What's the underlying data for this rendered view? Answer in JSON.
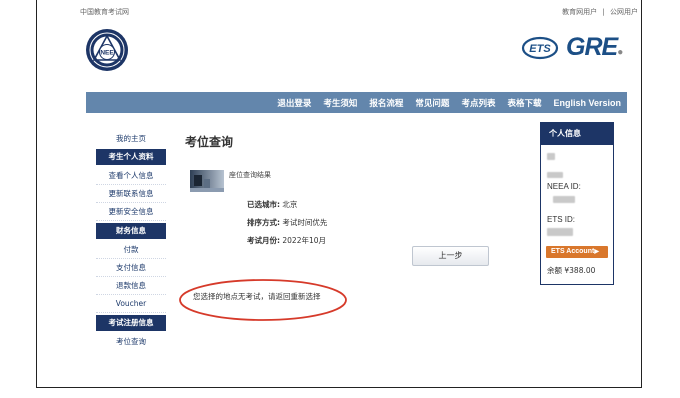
{
  "header": {
    "site_name": "中国教育考试网",
    "user_links": [
      "教育网用户",
      "公网用户"
    ],
    "link_sep": "|",
    "gre_logo": "GRE",
    "gre_dot": "●"
  },
  "nav": {
    "items": [
      "退出登录",
      "考生须知",
      "报名流程",
      "常见问题",
      "考点列表",
      "表格下载",
      "English Version"
    ]
  },
  "sidebar": {
    "home": "我的主页",
    "section1": "考生个人资料",
    "items1": [
      "查看个人信息",
      "更新联系信息",
      "更新安全信息"
    ],
    "section2": "财务信息",
    "items2": [
      "付款",
      "支付信息",
      "退款信息",
      "Voucher"
    ],
    "section3": "考试注册信息",
    "items3": [
      "考位查询"
    ]
  },
  "main": {
    "title": "考位查询",
    "result_label": "座位查询结果",
    "city_label": "已选城市:",
    "city_value": "北京",
    "sort_label": "排序方式:",
    "sort_value": "考试时间优先",
    "month_label": "考试月份:",
    "month_value": "2022年10月",
    "back_button": "上一步",
    "notice": "您选择的地点无考试，请返回重新选择"
  },
  "panel": {
    "title": "个人信息",
    "neea_label": "NEEA ID:",
    "ets_label": "ETS ID:",
    "ets_account_button": "ETS Account",
    "ets_arrow": "▶",
    "balance": "余额 ¥388.00"
  },
  "colors": {
    "nav_bg": "#6386ac",
    "dark_navy": "#1d3566",
    "ets_orange": "#d9772c",
    "gre_blue": "#1c4f86",
    "ellipse_red": "#d63a2a"
  }
}
